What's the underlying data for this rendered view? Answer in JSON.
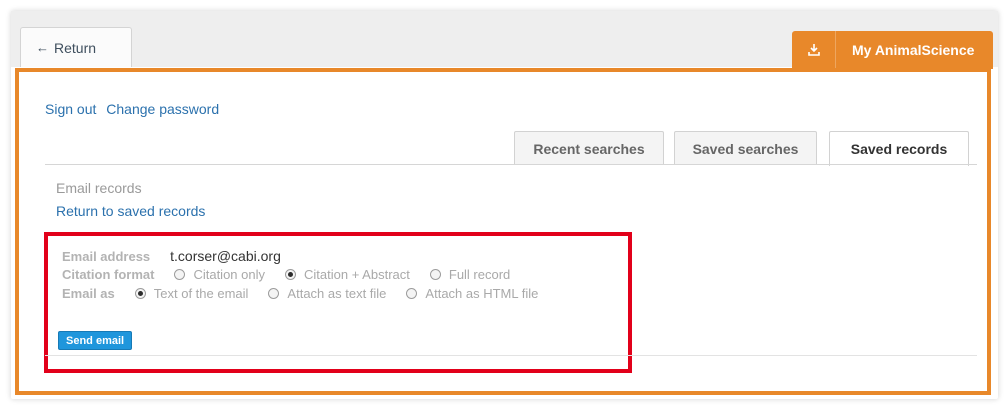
{
  "nav": {
    "return_arrow": "←",
    "return_label": "Return",
    "my_icon": "download-icon",
    "my_label": "My AnimalScience"
  },
  "account": {
    "sign_out": "Sign out",
    "change_password": "Change password"
  },
  "tabs": [
    {
      "label": "Recent searches",
      "active": false
    },
    {
      "label": "Saved searches",
      "active": false
    },
    {
      "label": "Saved records",
      "active": true
    }
  ],
  "section": {
    "title": "Email records",
    "back_link": "Return to saved records"
  },
  "form": {
    "email_label": "Email address",
    "email_value": "t.corser@cabi.org",
    "citation_label": "Citation format",
    "citation_options": [
      {
        "label": "Citation only",
        "selected": false
      },
      {
        "label": "Citation + Abstract",
        "selected": true
      },
      {
        "label": "Full record",
        "selected": false
      }
    ],
    "email_as_label": "Email as",
    "email_as_options": [
      {
        "label": "Text of the email",
        "selected": true
      },
      {
        "label": "Attach as text file",
        "selected": false
      },
      {
        "label": "Attach as HTML file",
        "selected": false
      }
    ],
    "send_button": "Send email"
  },
  "colors": {
    "accent_orange": "#e8882a",
    "highlight_red": "#e2001a",
    "link_blue": "#2b71ad",
    "button_blue": "#1f96dc"
  }
}
